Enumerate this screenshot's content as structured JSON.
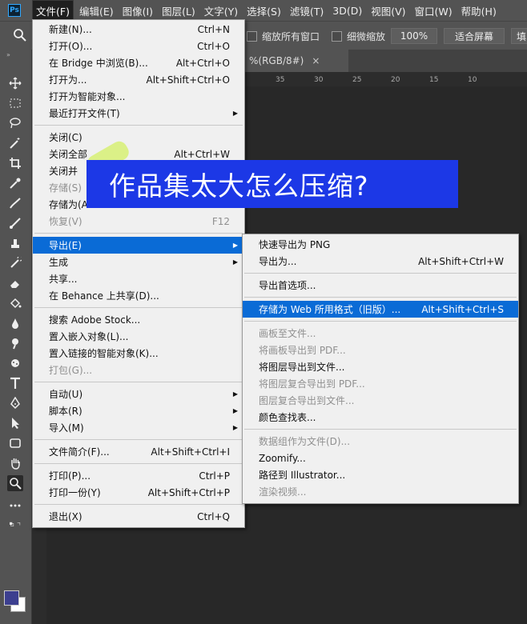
{
  "menubar": {
    "logo": "Ps",
    "items": [
      "文件(F)",
      "编辑(E)",
      "图像(I)",
      "图层(L)",
      "文字(Y)",
      "选择(S)",
      "滤镜(T)",
      "3D(D)",
      "视图(V)",
      "窗口(W)",
      "帮助(H)"
    ]
  },
  "options": {
    "check_all_windows": "缩放所有窗口",
    "check_scrubby": "细微缩放",
    "zoom_value": "100%",
    "fit_screen": "适合屏幕",
    "fill_screen": "填"
  },
  "document_tab": {
    "label": "%(RGB/8#)",
    "close": "×"
  },
  "ruler_ticks": [
    "35",
    "30",
    "25",
    "20",
    "15",
    "10"
  ],
  "file_menu": {
    "items": [
      {
        "label": "新建(N)...",
        "shortcut": "Ctrl+N"
      },
      {
        "label": "打开(O)...",
        "shortcut": "Ctrl+O"
      },
      {
        "label": "在 Bridge 中浏览(B)...",
        "shortcut": "Alt+Ctrl+O"
      },
      {
        "label": "打开为...",
        "shortcut": "Alt+Shift+Ctrl+O"
      },
      {
        "label": "打开为智能对象...",
        "shortcut": ""
      },
      {
        "label": "最近打开文件(T)",
        "shortcut": ""
      },
      {
        "label": "关闭(C)",
        "shortcut": ""
      },
      {
        "label": "关闭全部",
        "shortcut": "Alt+Ctrl+W"
      },
      {
        "label": "关闭并",
        "shortcut": ""
      },
      {
        "label": "存储(S)",
        "shortcut": ""
      },
      {
        "label": "存储为(A",
        "shortcut": ""
      },
      {
        "label": "恢复(V)",
        "shortcut": "F12"
      },
      {
        "label": "导出(E)",
        "shortcut": ""
      },
      {
        "label": "生成",
        "shortcut": ""
      },
      {
        "label": "共享...",
        "shortcut": ""
      },
      {
        "label": "在 Behance 上共享(D)...",
        "shortcut": ""
      },
      {
        "label": "搜索 Adobe Stock...",
        "shortcut": ""
      },
      {
        "label": "置入嵌入对象(L)...",
        "shortcut": ""
      },
      {
        "label": "置入链接的智能对象(K)...",
        "shortcut": ""
      },
      {
        "label": "打包(G)...",
        "shortcut": ""
      },
      {
        "label": "自动(U)",
        "shortcut": ""
      },
      {
        "label": "脚本(R)",
        "shortcut": ""
      },
      {
        "label": "导入(M)",
        "shortcut": ""
      },
      {
        "label": "文件简介(F)...",
        "shortcut": "Alt+Shift+Ctrl+I"
      },
      {
        "label": "打印(P)...",
        "shortcut": "Ctrl+P"
      },
      {
        "label": "打印一份(Y)",
        "shortcut": "Alt+Shift+Ctrl+P"
      },
      {
        "label": "退出(X)",
        "shortcut": "Ctrl+Q"
      }
    ]
  },
  "export_menu": {
    "items": [
      {
        "label": "快速导出为 PNG",
        "shortcut": ""
      },
      {
        "label": "导出为...",
        "shortcut": "Alt+Shift+Ctrl+W"
      },
      {
        "label": "导出首选项...",
        "shortcut": ""
      },
      {
        "label": "存储为 Web 所用格式（旧版）...",
        "shortcut": "Alt+Shift+Ctrl+S"
      },
      {
        "label": "画板至文件...",
        "shortcut": ""
      },
      {
        "label": "将画板导出到 PDF...",
        "shortcut": ""
      },
      {
        "label": "将图层导出到文件...",
        "shortcut": ""
      },
      {
        "label": "将图层复合导出到 PDF...",
        "shortcut": ""
      },
      {
        "label": "图层复合导出到文件...",
        "shortcut": ""
      },
      {
        "label": "颜色查找表...",
        "shortcut": ""
      },
      {
        "label": "数据组作为文件(D)...",
        "shortcut": ""
      },
      {
        "label": "Zoomify...",
        "shortcut": ""
      },
      {
        "label": "路径到 Illustrator...",
        "shortcut": ""
      },
      {
        "label": "渲染视频...",
        "shortcut": ""
      }
    ]
  },
  "banner": {
    "text": "作品集太大怎么压缩?"
  },
  "colors": {
    "highlight": "#0a6bd6",
    "banner": "#1c38e6",
    "foreground": "#3c3f8f"
  }
}
